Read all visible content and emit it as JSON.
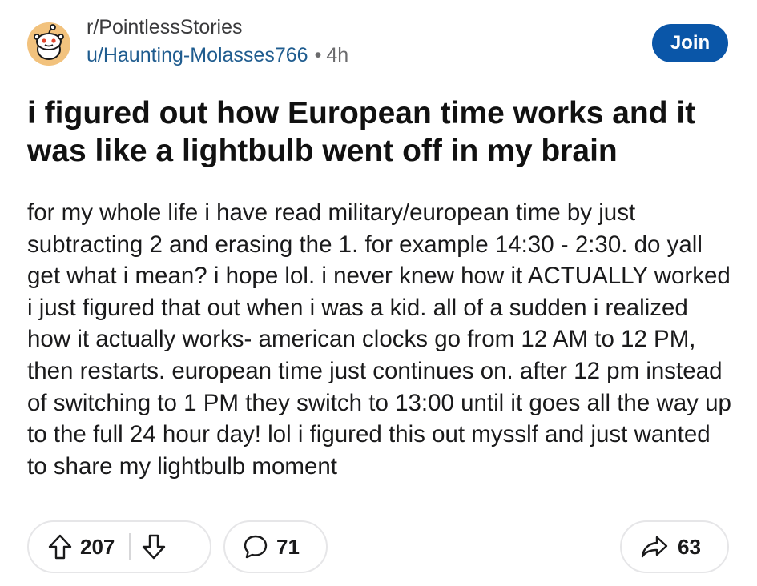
{
  "post": {
    "subreddit": "r/PointlessStories",
    "author": "u/Haunting-Molasses766",
    "separator": "•",
    "age": "4h",
    "join_label": "Join",
    "title": "i figured out how European time works and it was like a lightbulb went off in my brain",
    "body": "for my whole life i have read military/european time by just subtracting 2 and erasing the 1.  for example 14:30 - 2:30. do yall get what i mean? i hope lol. i never knew how it ACTUALLY worked i just figured that out when i was a kid. all of a sudden i realized how it actually works- american clocks go from 12 AM to 12 PM, then restarts. european time just continues on. after 12 pm instead of switching to 1 PM they switch to 13:00 until it goes all the way up to the full 24 hour day! lol i figured this out mysslf and just wanted to share my lightbulb moment"
  },
  "actions": {
    "upvotes": "207",
    "comments": "71",
    "shares": "63"
  },
  "icons": {
    "avatar": "reddit-snoo-avatar-icon",
    "upvote": "upvote-arrow-icon",
    "downvote": "downvote-arrow-icon",
    "comment": "comment-bubble-icon",
    "share": "share-arrow-icon"
  },
  "colors": {
    "join_button": "#0a56a8",
    "author_link": "#1f5c8f",
    "avatar_background": "#f2c27d"
  }
}
